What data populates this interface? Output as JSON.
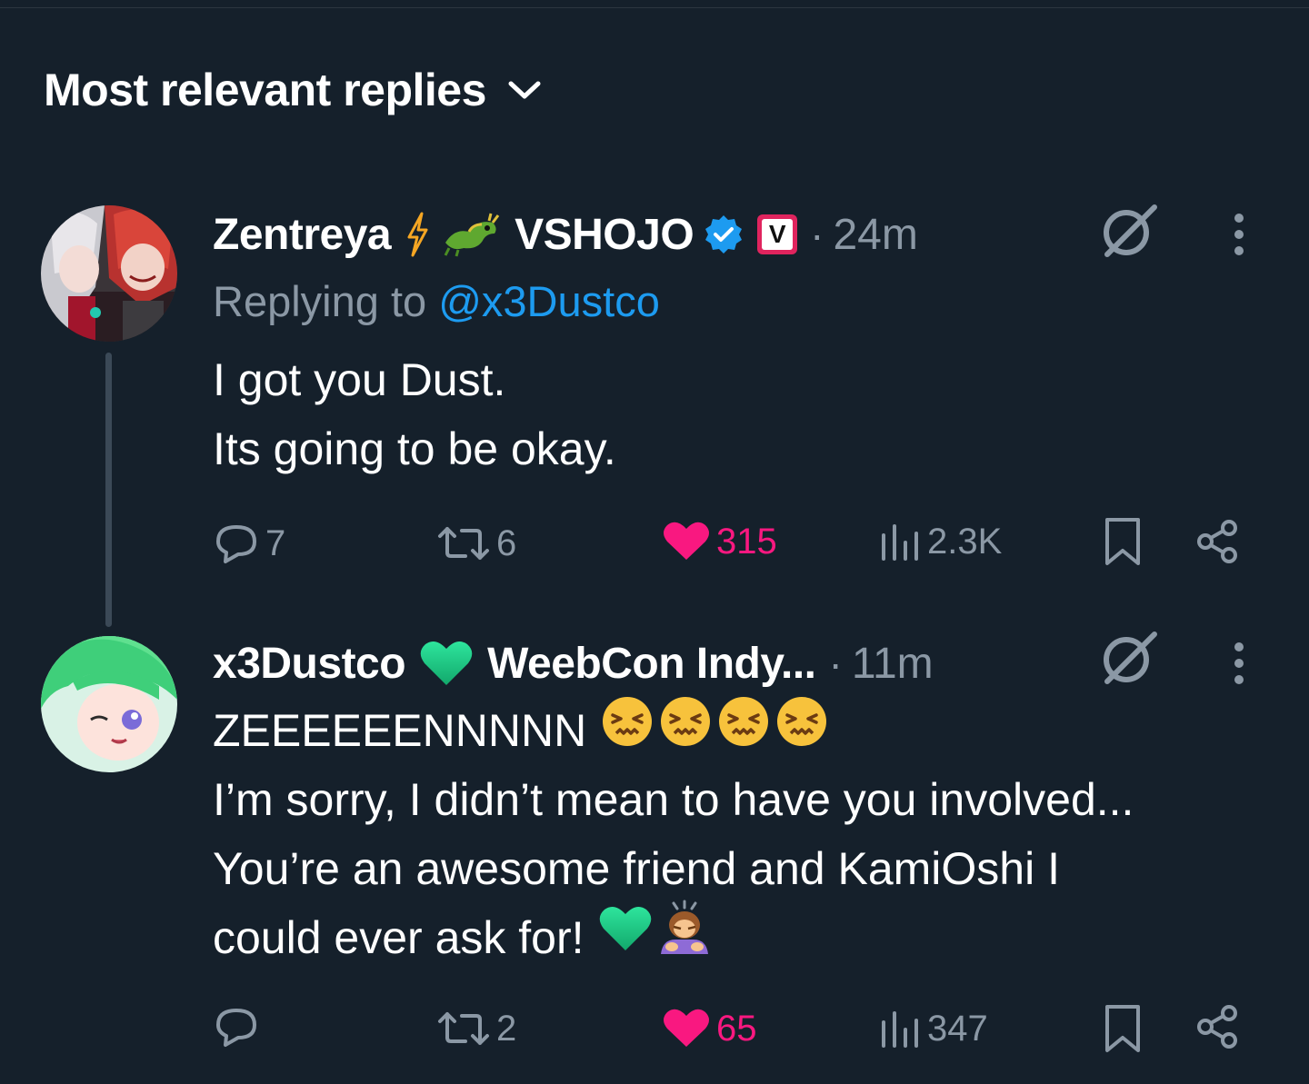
{
  "header": {
    "sort_label": "Most relevant replies"
  },
  "replies": [
    {
      "display_name": "Zentreya",
      "name_suffix": "VSHOJO",
      "name_emojis": [
        "lightning-emoji",
        "dragon-emoji"
      ],
      "verified_badge": "verified-badge-icon",
      "affiliate_badge": "V",
      "time": "24m",
      "replying_prefix": "Replying to",
      "replying_to": "@x3Dustco",
      "text_lines": [
        "I got you Dust.",
        "Its going to be okay."
      ],
      "stats": {
        "replies": "7",
        "reposts": "6",
        "likes": "315",
        "views": "2.3K"
      },
      "liked": true,
      "accent": "#1d9bf0"
    },
    {
      "display_name": "x3Dustco",
      "name_suffix": "WeebCon Indy...",
      "name_emojis": [
        "green-heart-emoji"
      ],
      "time": "11m",
      "text_lines": [
        "ZEEEEEENNNNN",
        "I’m sorry, I didn’t mean to have you involved...",
        "You’re an awesome friend and KamiOshi I",
        "could ever ask for!"
      ],
      "line_emojis": [
        [
          "confounded-face-emoji",
          "confounded-face-emoji",
          "confounded-face-emoji",
          "confounded-face-emoji"
        ],
        [],
        [],
        [
          "green-heart-emoji",
          "person-bowing-emoji"
        ]
      ],
      "stats": {
        "replies": "",
        "reposts": "2",
        "likes": "65",
        "views": "347"
      },
      "liked": true
    }
  ],
  "colors": {
    "background": "#15202b",
    "muted": "#8b98a5",
    "link": "#1d9bf0",
    "like": "#f91880",
    "affiliate": "#e0245e"
  }
}
